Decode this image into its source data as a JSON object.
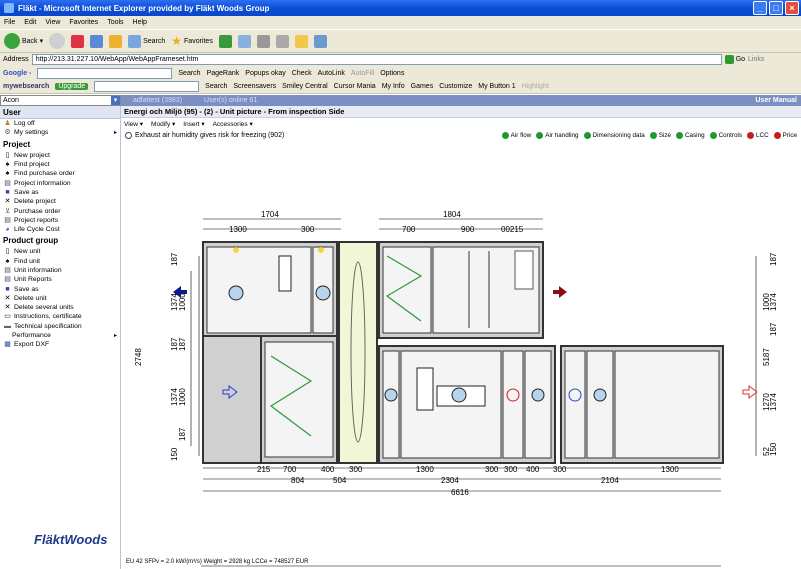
{
  "window": {
    "title": "Fläkt - Microsoft Internet Explorer provided by Fläkt Woods Group"
  },
  "menu": [
    "File",
    "Edit",
    "View",
    "Favorites",
    "Tools",
    "Help"
  ],
  "toolbar": {
    "back": "Back",
    "search": "Search",
    "favorites": "Favorites"
  },
  "address": {
    "label": "Address",
    "url": "http://213.31.227.10/WebApp/WebAppFrameset.htm",
    "go": "Go",
    "links": "Links"
  },
  "google": {
    "label": "Google -",
    "search": "Search",
    "pagerank": "PageRank",
    "popups": "Popups okay",
    "check": "Check",
    "autolink": "AutoLink",
    "autofill": "AutoFill",
    "options": "Options"
  },
  "websearch": {
    "label": "mywebsearch",
    "upgrade": "Upgrade",
    "items": [
      "Search",
      "Screensavers",
      "Smiley Central",
      "Cursor Mania",
      "My Info",
      "Games",
      "Customize",
      "My Button 1",
      "Highlight"
    ]
  },
  "app": {
    "select_value": "Acon",
    "user": "adfattest (3983)",
    "users_online": "User(s) online 61",
    "manual": "User Manual"
  },
  "sidebar": {
    "user_header": "User",
    "user_items": [
      {
        "label": "Log off"
      },
      {
        "label": "My settings"
      }
    ],
    "project_header": "Project",
    "project_items": [
      {
        "label": "New project"
      },
      {
        "label": "Find project"
      },
      {
        "label": "Find purchase order"
      },
      {
        "label": "Project information"
      },
      {
        "label": "Save as"
      },
      {
        "label": "Delete project"
      },
      {
        "label": "Purchase order"
      },
      {
        "label": "Project reports"
      },
      {
        "label": "Life Cycle Cost"
      }
    ],
    "product_header": "Product group",
    "product_items": [
      {
        "label": "New unit"
      },
      {
        "label": "Find unit"
      },
      {
        "label": "Unit information"
      },
      {
        "label": "Unit Reports"
      },
      {
        "label": "Save as"
      },
      {
        "label": "Delete unit"
      },
      {
        "label": "Delete several units"
      },
      {
        "label": "Instructions, certificate"
      },
      {
        "label": "Technical specification"
      },
      {
        "label": "Performance"
      },
      {
        "label": "Export DXF"
      }
    ],
    "logo": "FläktWoods"
  },
  "main": {
    "title": "Energi och Miljö (95) - (2) - Unit picture - From inspection Side",
    "menus": [
      "View ▾",
      "Modify ▾",
      "Insert ▾",
      "Accessories ▾"
    ],
    "legend": [
      {
        "label": "Air flow",
        "color": "#1d9a2e"
      },
      {
        "label": "Air handling",
        "color": "#1d9a2e"
      },
      {
        "label": "Dimensioning data",
        "color": "#1d9a2e"
      },
      {
        "label": "Size",
        "color": "#1d9a2e"
      },
      {
        "label": "Casing",
        "color": "#1d9a2e"
      },
      {
        "label": "Controls",
        "color": "#1d9a2e"
      },
      {
        "label": "LCC",
        "color": "#c02020"
      },
      {
        "label": "Price",
        "color": "#c02020"
      }
    ],
    "warning": "Exhaust air humidity gives risk for freezing (902)",
    "footer": "EU 42 SFPv = 2.0 kW/(m³/s) Weight = 2928 kg LCCe = 748527 EUR"
  },
  "dims": {
    "top_upper": [
      "1704",
      "1804"
    ],
    "top_lower": [
      "1300",
      "300",
      "700",
      "900",
      "00215"
    ],
    "bottom_upper": [
      "215",
      "700",
      "400",
      "300",
      "1300",
      "300",
      "300",
      "400",
      "300",
      "1300"
    ],
    "bottom_lower": [
      "804",
      "504",
      "2304",
      "2104"
    ],
    "bottom_total": "6616",
    "left": [
      "187",
      "1374",
      "1000",
      "187",
      "187",
      "2748",
      "1374",
      "1000",
      "187",
      "150"
    ],
    "right": [
      "187",
      "1000",
      "1374",
      "187",
      "5187",
      "1270",
      "1374",
      "52",
      "150"
    ]
  }
}
